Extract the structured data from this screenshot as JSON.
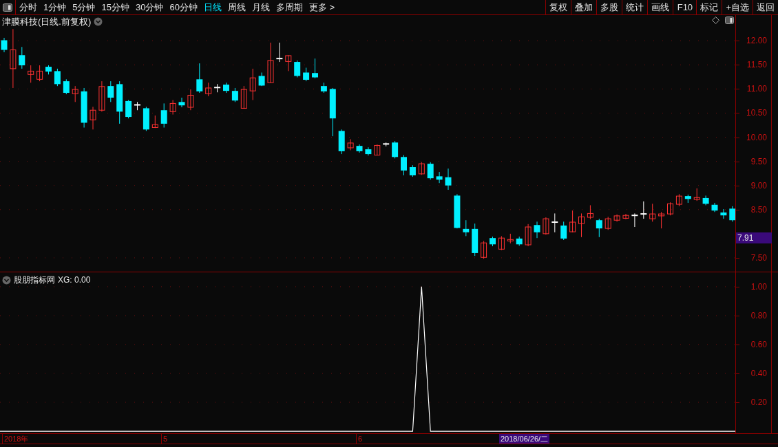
{
  "toolbar": {
    "periods": [
      {
        "label": "分时",
        "selected": false
      },
      {
        "label": "1分钟",
        "selected": false
      },
      {
        "label": "5分钟",
        "selected": false
      },
      {
        "label": "15分钟",
        "selected": false
      },
      {
        "label": "30分钟",
        "selected": false
      },
      {
        "label": "60分钟",
        "selected": false
      },
      {
        "label": "日线",
        "selected": true
      },
      {
        "label": "周线",
        "selected": false
      },
      {
        "label": "月线",
        "selected": false
      },
      {
        "label": "多周期",
        "selected": false
      },
      {
        "label": "更多 >",
        "selected": false
      }
    ],
    "buttons": [
      "复权",
      "叠加",
      "多股",
      "统计",
      "画线",
      "F10",
      "标记",
      "+自选",
      "返回"
    ]
  },
  "main_chart": {
    "title": "津膜科技(日线.前复权)",
    "last_price": "7.91",
    "chart_data": {
      "type": "candlestick",
      "ylim": [
        7.2,
        12.53
      ],
      "grid": true,
      "yticks": [
        {
          "value": 12,
          "label": "12.00"
        },
        {
          "value": 11.5,
          "label": "11.50"
        },
        {
          "value": 11,
          "label": "11.00"
        },
        {
          "value": 10.5,
          "label": "10.50"
        },
        {
          "value": 10,
          "label": "10.00"
        },
        {
          "value": 9.5,
          "label": "9.50"
        },
        {
          "value": 9,
          "label": "9.00"
        },
        {
          "value": 8.5,
          "label": "8.50"
        },
        {
          "value": 7.5,
          "label": "7.50"
        }
      ],
      "ohlc": [
        [
          12.01,
          12.06,
          11.76,
          11.81
        ],
        [
          11.42,
          12.24,
          11.02,
          11.81
        ],
        [
          11.7,
          11.87,
          11.42,
          11.49
        ],
        [
          11.3,
          11.49,
          11.13,
          11.37
        ],
        [
          11.2,
          11.49,
          11.16,
          11.37
        ],
        [
          11.46,
          11.49,
          11.3,
          11.36
        ],
        [
          11.37,
          11.42,
          11.06,
          11.1
        ],
        [
          11.16,
          11.2,
          10.89,
          10.92
        ],
        [
          10.9,
          11.06,
          10.73,
          10.99
        ],
        [
          10.95,
          11.02,
          10.2,
          10.3
        ],
        [
          10.36,
          10.63,
          10.16,
          10.56
        ],
        [
          10.56,
          11.16,
          10.53,
          11.05
        ],
        [
          11.06,
          11.16,
          10.73,
          10.82
        ],
        [
          11.1,
          11.16,
          10.28,
          10.53
        ],
        [
          10.75,
          10.77,
          10.39,
          10.42
        ],
        [
          10.67,
          10.73,
          10.56,
          10.67
        ],
        [
          10.6,
          10.63,
          10.13,
          10.16
        ],
        [
          10.2,
          10.45,
          10.19,
          10.26
        ],
        [
          10.56,
          10.7,
          10.2,
          10.28
        ],
        [
          10.53,
          10.77,
          10.47,
          10.7
        ],
        [
          10.73,
          10.82,
          10.62,
          10.66
        ],
        [
          10.62,
          10.99,
          10.56,
          10.87
        ],
        [
          11.2,
          11.53,
          10.92,
          10.95
        ],
        [
          10.9,
          11.13,
          10.85,
          11.02
        ],
        [
          11.03,
          11.1,
          10.93,
          11.03
        ],
        [
          11.09,
          11.13,
          10.92,
          10.96
        ],
        [
          10.96,
          11.02,
          10.73,
          10.76
        ],
        [
          10.6,
          11.06,
          10.59,
          10.99
        ],
        [
          10.96,
          11.42,
          10.77,
          11.23
        ],
        [
          11.27,
          11.34,
          11.06,
          11.07
        ],
        [
          11.13,
          11.96,
          11.13,
          11.59
        ],
        [
          11.63,
          11.96,
          11.56,
          11.63
        ],
        [
          11.57,
          11.7,
          11.37,
          11.69
        ],
        [
          11.56,
          11.59,
          11.24,
          11.27
        ],
        [
          11.34,
          11.44,
          11.16,
          11.19
        ],
        [
          11.33,
          11.63,
          11.22,
          11.24
        ],
        [
          11.06,
          11.13,
          10.92,
          10.95
        ],
        [
          11.0,
          11.02,
          10.02,
          10.39
        ],
        [
          10.13,
          10.16,
          9.65,
          9.71
        ],
        [
          9.78,
          9.96,
          9.73,
          9.88
        ],
        [
          9.82,
          9.85,
          9.68,
          9.71
        ],
        [
          9.75,
          9.79,
          9.62,
          9.65
        ],
        [
          9.63,
          9.85,
          9.62,
          9.83
        ],
        [
          9.86,
          9.89,
          9.81,
          9.86
        ],
        [
          9.89,
          9.92,
          9.56,
          9.59
        ],
        [
          9.59,
          9.63,
          9.21,
          9.31
        ],
        [
          9.38,
          9.42,
          9.18,
          9.21
        ],
        [
          9.24,
          9.48,
          9.22,
          9.45
        ],
        [
          9.45,
          9.48,
          9.12,
          9.15
        ],
        [
          9.19,
          9.28,
          9.05,
          9.12
        ],
        [
          9.17,
          9.35,
          8.91,
          9.0
        ],
        [
          8.79,
          8.82,
          8.11,
          8.12
        ],
        [
          8.1,
          8.28,
          7.95,
          8.03
        ],
        [
          8.1,
          8.21,
          7.54,
          7.6
        ],
        [
          7.51,
          7.85,
          7.48,
          7.81
        ],
        [
          7.91,
          7.94,
          7.74,
          7.78
        ],
        [
          7.68,
          7.95,
          7.66,
          7.91
        ],
        [
          7.85,
          8.0,
          7.8,
          7.88
        ],
        [
          7.9,
          7.94,
          7.75,
          7.78
        ],
        [
          7.77,
          8.2,
          7.74,
          8.14
        ],
        [
          8.18,
          8.25,
          7.91,
          8.03
        ],
        [
          8.0,
          8.34,
          7.98,
          8.31
        ],
        [
          8.24,
          8.42,
          8.03,
          8.24
        ],
        [
          8.17,
          8.25,
          7.87,
          7.9
        ],
        [
          8.04,
          8.48,
          8.03,
          8.24
        ],
        [
          8.21,
          8.42,
          7.93,
          8.35
        ],
        [
          8.34,
          8.59,
          8.3,
          8.42
        ],
        [
          8.28,
          8.31,
          7.93,
          8.11
        ],
        [
          8.11,
          8.35,
          8.08,
          8.31
        ],
        [
          8.28,
          8.4,
          8.25,
          8.37
        ],
        [
          8.32,
          8.41,
          8.3,
          8.38
        ],
        [
          8.38,
          8.42,
          8.14,
          8.38
        ],
        [
          8.41,
          8.67,
          8.31,
          8.41
        ],
        [
          8.31,
          8.62,
          8.25,
          8.41
        ],
        [
          8.37,
          8.45,
          8.11,
          8.41
        ],
        [
          8.41,
          8.65,
          8.38,
          8.62
        ],
        [
          8.61,
          8.82,
          8.57,
          8.78
        ],
        [
          8.78,
          8.81,
          8.64,
          8.72
        ],
        [
          8.71,
          8.94,
          8.68,
          8.75
        ],
        [
          8.74,
          8.79,
          8.59,
          8.62
        ],
        [
          8.6,
          8.64,
          8.45,
          8.48
        ],
        [
          8.44,
          8.51,
          8.31,
          8.38
        ],
        [
          8.52,
          8.57,
          8.25,
          8.28
        ]
      ]
    }
  },
  "indicator": {
    "name": "股朋指标网",
    "reading": "XG: 0.00",
    "chart_data": {
      "type": "line",
      "ylim": [
        -0.014,
        1.09
      ],
      "grid": true,
      "yticks": [
        {
          "value": 1,
          "label": "1.00"
        },
        {
          "value": 0.8,
          "label": "0.80"
        },
        {
          "value": 0.6,
          "label": "0.60"
        },
        {
          "value": 0.4,
          "label": "0.40"
        },
        {
          "value": 0.2,
          "label": "0.20"
        }
      ],
      "series": [
        {
          "color": "#ffffff",
          "values": [
            0,
            0,
            0,
            0,
            0,
            0,
            0,
            0,
            0,
            0,
            0,
            0,
            0,
            0,
            0,
            0,
            0,
            0,
            0,
            0,
            0,
            0,
            0,
            0,
            0,
            0,
            0,
            0,
            0,
            0,
            0,
            0,
            0,
            0,
            0,
            0,
            0,
            0,
            0,
            0,
            0,
            0,
            0,
            0,
            0,
            0,
            0,
            1,
            0,
            0,
            0,
            0,
            0,
            0,
            0,
            0,
            0,
            0,
            0,
            0,
            0,
            0,
            0,
            0,
            0,
            0,
            0,
            0,
            0,
            0,
            0,
            0,
            0,
            0,
            0,
            0,
            0,
            0,
            0,
            0,
            0,
            0,
            0
          ]
        }
      ]
    }
  },
  "time_axis": {
    "labels": [
      "2018年",
      "5",
      "6"
    ],
    "cursor_date": "2018/06/26/二"
  }
}
